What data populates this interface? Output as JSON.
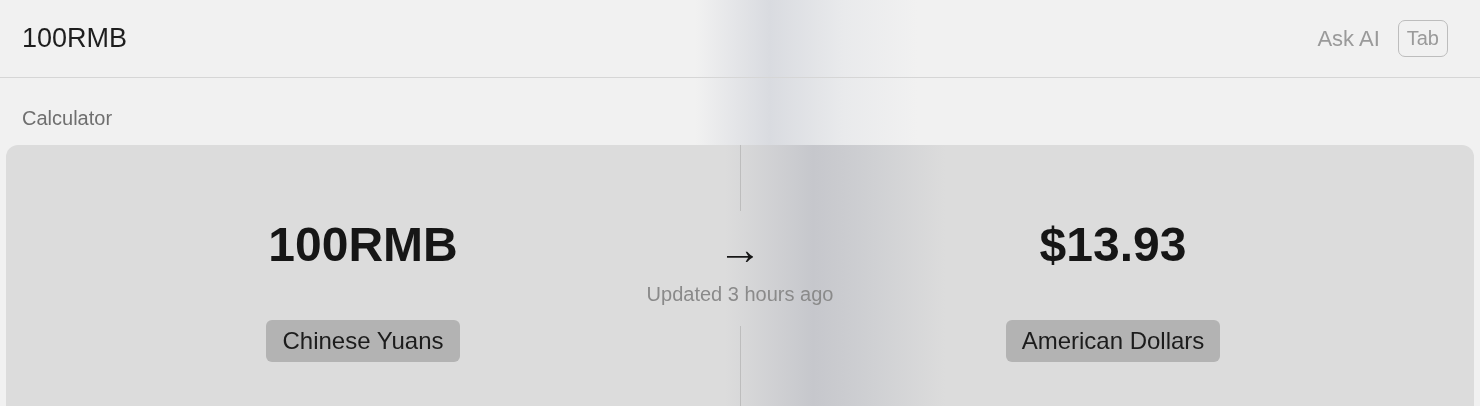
{
  "search": {
    "value": "100RMB"
  },
  "ask_ai": {
    "label": "Ask AI",
    "shortcut": "Tab"
  },
  "section": {
    "title": "Calculator"
  },
  "conversion": {
    "from": {
      "value": "100RMB",
      "unit": "Chinese Yuans"
    },
    "arrow": "→",
    "updated": "Updated 3 hours ago",
    "to": {
      "value": "$13.93",
      "unit": "American Dollars"
    }
  }
}
